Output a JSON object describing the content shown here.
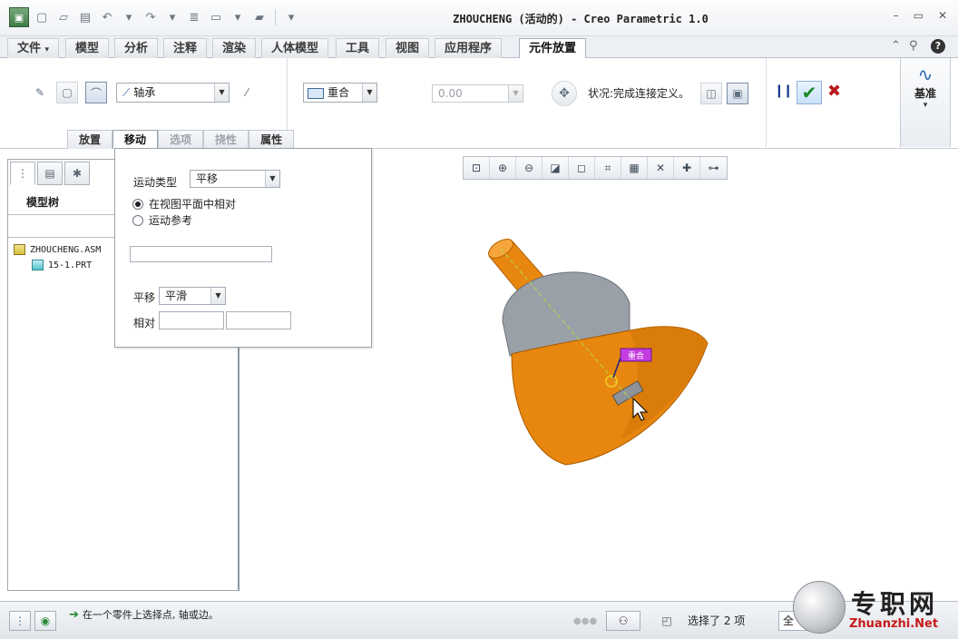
{
  "window": {
    "title": "ZHOUCHENG (活动的) - Creo Parametric 1.0"
  },
  "ribbon_tabs": [
    {
      "label": "文件",
      "dropdown": "▾"
    },
    {
      "label": "模型"
    },
    {
      "label": "分析"
    },
    {
      "label": "注释"
    },
    {
      "label": "渲染"
    },
    {
      "label": "人体模型"
    },
    {
      "label": "工具"
    },
    {
      "label": "视图"
    },
    {
      "label": "应用程序"
    },
    {
      "label": "元件放置"
    }
  ],
  "ribbon": {
    "constraint_set": "轴承",
    "constraint_type": "重合",
    "offset_value": "0.00",
    "status_text": "状况:完成连接定义。",
    "datum_label": "基准",
    "datum_arrow": "▾"
  },
  "sub_tabs": [
    {
      "label": "放置",
      "state": "normal"
    },
    {
      "label": "移动",
      "state": "active"
    },
    {
      "label": "选项",
      "state": "disabled"
    },
    {
      "label": "挠性",
      "state": "disabled"
    },
    {
      "label": "属性",
      "state": "normal"
    }
  ],
  "move_panel": {
    "motion_type_label": "运动类型",
    "motion_type_value": "平移",
    "radio_view_plane": "在视图平面中相对",
    "radio_motion_ref": "运动参考",
    "translation_label": "平移",
    "translation_value": "平滑",
    "relative_label": "相对"
  },
  "navigator": {
    "title": "模型树",
    "tree": [
      {
        "label": "ZHOUCHENG.ASM",
        "kind": "assembly"
      },
      {
        "label": "15-1.PRT",
        "kind": "part"
      }
    ]
  },
  "graphics": {
    "constraint_tag": "重合"
  },
  "statusbar": {
    "message": "在一个零件上选择点, 轴或边。",
    "selection": "选择了 2 项",
    "filter_value": "全"
  },
  "watermark": {
    "cn": "专职网",
    "en": "Zhuanzhi.Net"
  },
  "colors": {
    "part_orange": "#e8870f",
    "part_gray": "#9aa0a8",
    "ok_green": "#1a8a2a",
    "cancel_red": "#b8181a"
  }
}
